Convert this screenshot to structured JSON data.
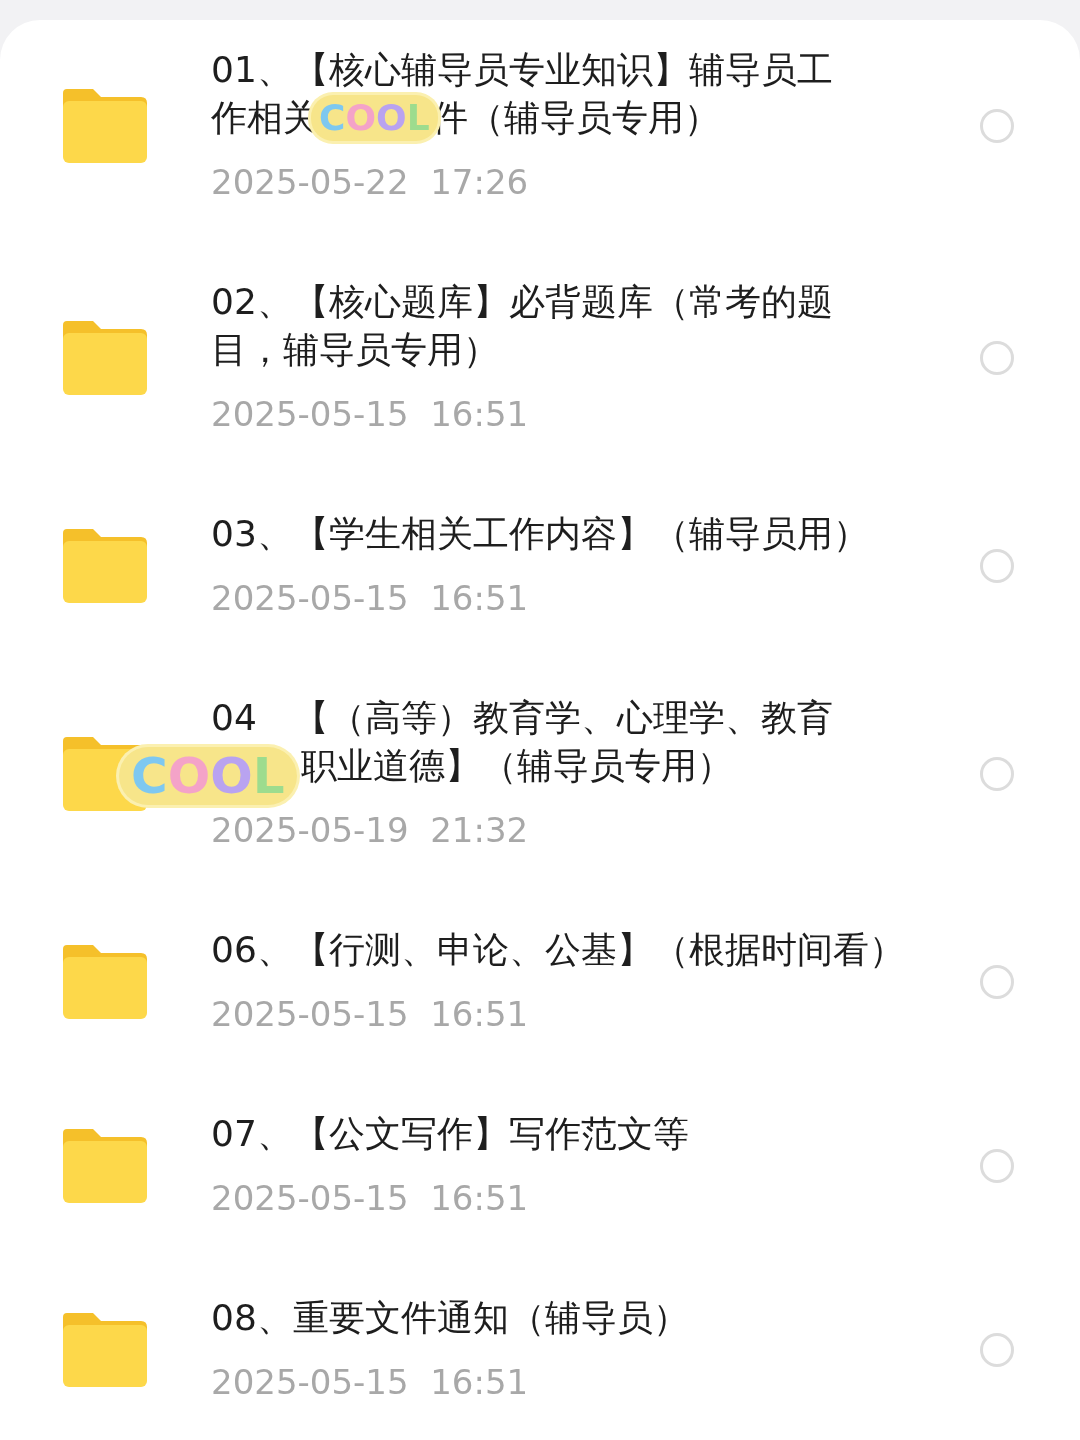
{
  "files": [
    {
      "kind": "folder",
      "selected": false,
      "title_lines": [
        [
          {
            "kind": "text",
            "text": "01、【核心辅导员专业知识】辅导员工"
          }
        ],
        [
          {
            "kind": "text",
            "text": "作相关"
          },
          {
            "kind": "sticker",
            "text": "COOL"
          },
          {
            "kind": "text",
            "text": "件（辅导员专用）"
          }
        ]
      ],
      "date": "2025-05-22  17:26"
    },
    {
      "kind": "folder",
      "selected": false,
      "title_lines": [
        [
          {
            "kind": "text",
            "text": "02、【核心题库】必背题库（常考的题"
          }
        ],
        [
          {
            "kind": "text",
            "text": "目，辅导员专用）"
          }
        ]
      ],
      "date": "2025-05-15  16:51"
    },
    {
      "kind": "folder",
      "selected": false,
      "title_lines": [
        [
          {
            "kind": "text",
            "text": "03、【学生相关工作内容】（辅导员用）"
          }
        ]
      ],
      "date": "2025-05-15  16:51"
    },
    {
      "kind": "folder",
      "selected": false,
      "title_lines": [
        [
          {
            "kind": "text",
            "text": "04"
          },
          {
            "kind": "text",
            "text": "【（高等）教育学、心理学、教育"
          }
        ],
        [
          {
            "kind": "sticker",
            "text": "COOL"
          },
          {
            "kind": "text",
            "text": "职业道德】（辅导员专用）"
          }
        ]
      ],
      "date": "2025-05-19  21:32"
    },
    {
      "kind": "folder",
      "selected": false,
      "title_lines": [
        [
          {
            "kind": "text",
            "text": "06、【行测、申论、公基】（根据时间看）"
          }
        ]
      ],
      "date": "2025-05-15  16:51"
    },
    {
      "kind": "folder",
      "selected": false,
      "title_lines": [
        [
          {
            "kind": "text",
            "text": "07、【公文写作】写作范文等"
          }
        ]
      ],
      "date": "2025-05-15  16:51"
    },
    {
      "kind": "folder",
      "selected": false,
      "title_lines": [
        [
          {
            "kind": "text",
            "text": "08、重要文件通知（辅导员）"
          }
        ]
      ],
      "date": "2025-05-15  16:51"
    }
  ]
}
